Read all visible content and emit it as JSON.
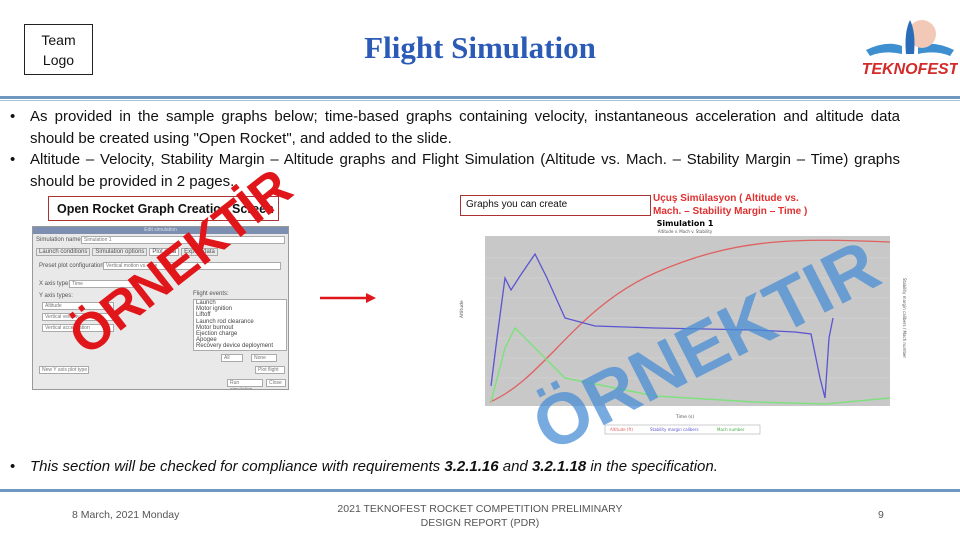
{
  "header": {
    "team_logo": "Team\nLogo",
    "title": "Flight Simulation",
    "brand_logo_text": "TEKNOFEST"
  },
  "bullets": [
    "As provided in the sample graphs below; time-based graphs containing velocity, instantaneous acceleration and altitude data should be created using \"Open Rocket\", and added to the slide.",
    "Altitude – Velocity, Stability Margin – Altitude graphs and Flight Simulation (Altitude vs. Mach. – Stability Margin – Time) graphs should be provided in 2 pages."
  ],
  "left_panel": {
    "label": "Open Rocket Graph Creation Screen",
    "screenshot": {
      "window_title": "Edit simulation",
      "sim_name_label": "Simulation name:",
      "sim_name_value": "Simulation 1",
      "tabs": [
        "Launch conditions",
        "Simulation options",
        "Plot data",
        "Export data"
      ],
      "preset_label": "Preset plot configurations:",
      "preset_value": "Vertical motion vs. time",
      "x_axis_label": "X axis type:",
      "x_axis_value": "Time",
      "y_axis_label": "Y axis types:",
      "y_axis_values": [
        "Altitude",
        "Vertical velocity",
        "Vertical acceleration"
      ],
      "flight_events_label": "Flight events:",
      "flight_events": [
        "Launch",
        "Motor ignition",
        "Liftoff",
        "Launch rod clearance",
        "Motor burnout",
        "Ejection charge",
        "Apogee",
        "Recovery device deployment"
      ],
      "all_button": "All",
      "none_button": "None",
      "new_axis_button": "New Y axis plot type",
      "plot_button": "Plot flight",
      "run_button": "Run simulation",
      "close_button": "Close"
    },
    "watermark": "ÖRNEKTİR"
  },
  "right_panel": {
    "label": "Graphs you can create",
    "caption": "Uçuş Simülasyon ( Altitude vs. Mach. – Stability Margin – Time )",
    "chart_title": "Simulation 1",
    "chart_subtitle": "Altitude v. Mach v. Stability",
    "xlabel": "Time (s)",
    "ylabel_left": "Altitude",
    "ylabel_right": "Stability margin calibers / Mach number",
    "legend": [
      "Altitude (ft)",
      "Stability margin calibers",
      "Mach number"
    ],
    "watermark": "ÖRNEKTIR",
    "colors": {
      "altitude": "#e06060",
      "stability": "#5a55d0",
      "mach": "#80e080"
    }
  },
  "bottom_bullet": {
    "prefix": "This section will be checked for compliance with requirements ",
    "req1": "3.2.1.16",
    "mid": " and ",
    "req2": "3.2.1.18",
    "suffix": " in the specification."
  },
  "footer": {
    "date": "8 March, 2021 Monday",
    "center": "2021 TEKNOFEST ROCKET COMPETITION PRELIMINARY DESIGN REPORT (PDR)",
    "page": "9"
  },
  "colors": {
    "title": "#2b5bb6",
    "rule": "#6f98c0",
    "arrow": "#e0161a",
    "box_border": "#a33333"
  }
}
